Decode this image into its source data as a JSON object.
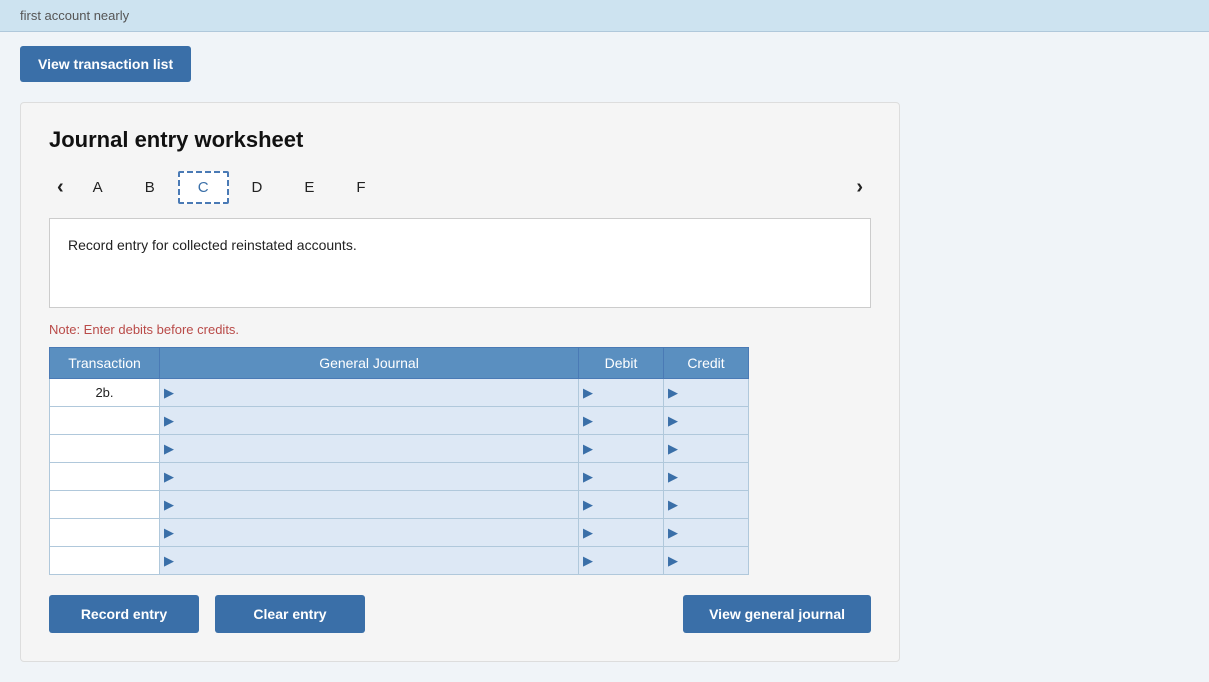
{
  "topbar": {
    "text": "first account nearly"
  },
  "header": {
    "view_transaction_btn": "View transaction list"
  },
  "worksheet": {
    "title": "Journal entry worksheet",
    "tabs": [
      {
        "label": "A",
        "active": false
      },
      {
        "label": "B",
        "active": false
      },
      {
        "label": "C",
        "active": true
      },
      {
        "label": "D",
        "active": false
      },
      {
        "label": "E",
        "active": false
      },
      {
        "label": "F",
        "active": false
      }
    ],
    "instruction": "Record entry for collected reinstated accounts.",
    "note": "Note: Enter debits before credits.",
    "table": {
      "headers": {
        "transaction": "Transaction",
        "general_journal": "General Journal",
        "debit": "Debit",
        "credit": "Credit"
      },
      "rows": [
        {
          "transaction": "2b.",
          "journal": "",
          "debit": "",
          "credit": ""
        },
        {
          "transaction": "",
          "journal": "",
          "debit": "",
          "credit": ""
        },
        {
          "transaction": "",
          "journal": "",
          "debit": "",
          "credit": ""
        },
        {
          "transaction": "",
          "journal": "",
          "debit": "",
          "credit": ""
        },
        {
          "transaction": "",
          "journal": "",
          "debit": "",
          "credit": ""
        },
        {
          "transaction": "",
          "journal": "",
          "debit": "",
          "credit": ""
        },
        {
          "transaction": "",
          "journal": "",
          "debit": "",
          "credit": ""
        }
      ]
    },
    "buttons": {
      "record_entry": "Record entry",
      "clear_entry": "Clear entry",
      "view_general_journal": "View general journal"
    }
  }
}
